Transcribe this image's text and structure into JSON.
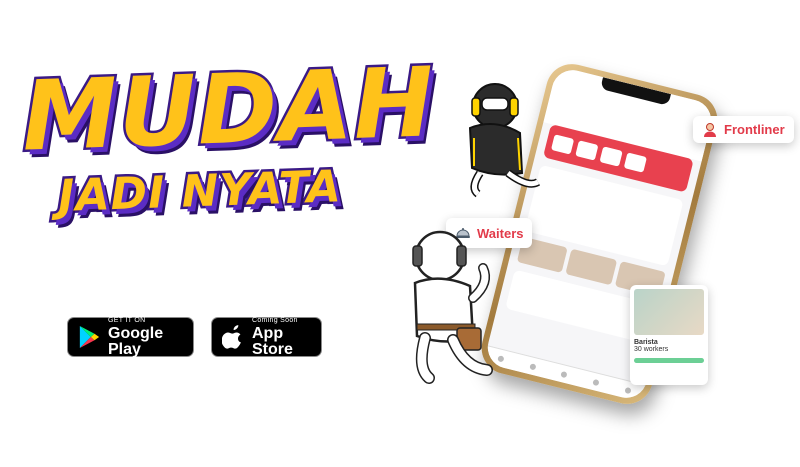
{
  "headline": {
    "title": "MUDAH",
    "subtitle": "JADI NYATA"
  },
  "badges": {
    "google_play": {
      "small": "GET IT ON",
      "big": "Google Play",
      "icon": "play-triangle-icon"
    },
    "app_store": {
      "small": "Coming Soon",
      "big": "App Store",
      "icon": "apple-icon"
    }
  },
  "chips": {
    "frontliner": {
      "label": "Frontliner",
      "icon": "person-icon"
    },
    "waiters": {
      "label": "Waiters",
      "icon": "cloche-icon"
    }
  },
  "barista_card": {
    "name": "Barista",
    "count": "30 workers"
  },
  "colors": {
    "title_fill": "#ffc21a",
    "title_outline": "#3b1a86",
    "accent_red": "#e23b4a",
    "progress_green": "#6ccf95"
  }
}
